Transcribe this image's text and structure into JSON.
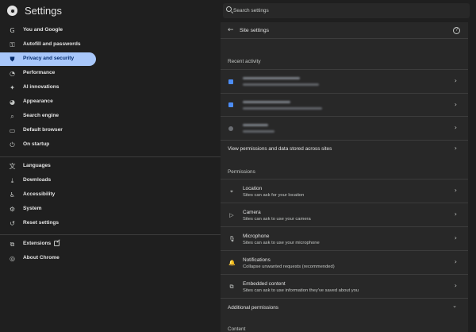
{
  "app": {
    "title": "Settings"
  },
  "search": {
    "placeholder": "Search settings"
  },
  "sidebar": {
    "items": [
      {
        "label": "You and Google",
        "icon": "google-icon",
        "glyph": "G"
      },
      {
        "label": "Autofill and passwords",
        "icon": "key-icon",
        "glyph": "⚿"
      },
      {
        "label": "Privacy and security",
        "icon": "shield-icon",
        "glyph": "⛊",
        "active": true
      },
      {
        "label": "Performance",
        "icon": "speedometer-icon",
        "glyph": "◔"
      },
      {
        "label": "AI innovations",
        "icon": "sparkle-icon",
        "glyph": "✦"
      },
      {
        "label": "Appearance",
        "icon": "palette-icon",
        "glyph": "◕"
      },
      {
        "label": "Search engine",
        "icon": "search-icon",
        "glyph": "⌕"
      },
      {
        "label": "Default browser",
        "icon": "browser-icon",
        "glyph": "▭"
      },
      {
        "label": "On startup",
        "icon": "power-icon",
        "glyph": "⏻"
      },
      {
        "label": "Languages",
        "icon": "translate-icon",
        "glyph": "文"
      },
      {
        "label": "Downloads",
        "icon": "download-icon",
        "glyph": "⤓"
      },
      {
        "label": "Accessibility",
        "icon": "accessibility-icon",
        "glyph": "♿"
      },
      {
        "label": "System",
        "icon": "wrench-icon",
        "glyph": "⚙"
      },
      {
        "label": "Reset settings",
        "icon": "reset-icon",
        "glyph": "↺"
      },
      {
        "label": "Extensions",
        "icon": "puzzle-icon",
        "glyph": "⧉"
      },
      {
        "label": "About Chrome",
        "icon": "chrome-icon",
        "glyph": "◎"
      }
    ]
  },
  "panel": {
    "title": "Site settings",
    "recent_activity_heading": "Recent activity",
    "recent_sites_count": 3,
    "view_permissions_label": "View permissions and data stored across sites",
    "permissions_heading": "Permissions",
    "permissions": [
      {
        "title": "Location",
        "subtitle": "Sites can ask for your location",
        "icon": "location-pin-icon",
        "glyph": "⌖"
      },
      {
        "title": "Camera",
        "subtitle": "Sites can ask to use your camera",
        "icon": "camera-icon",
        "glyph": "▷"
      },
      {
        "title": "Microphone",
        "subtitle": "Sites can ask to use your microphone",
        "icon": "microphone-icon",
        "glyph": "🎙"
      },
      {
        "title": "Notifications",
        "subtitle": "Collapse unwanted requests (recommended)",
        "icon": "bell-icon",
        "glyph": "🔔"
      },
      {
        "title": "Embedded content",
        "subtitle": "Sites can ask to use information they've saved about you",
        "icon": "embedded-content-icon",
        "glyph": "⧉"
      }
    ],
    "additional_permissions_label": "Additional permissions",
    "content_heading": "Content"
  },
  "colors": {
    "active_nav_bg": "#a8c7fa",
    "active_nav_text": "#062e6f",
    "panel_bg": "#282828",
    "page_bg": "#1f1f1f",
    "favicon_blue": "#4c8df6"
  }
}
